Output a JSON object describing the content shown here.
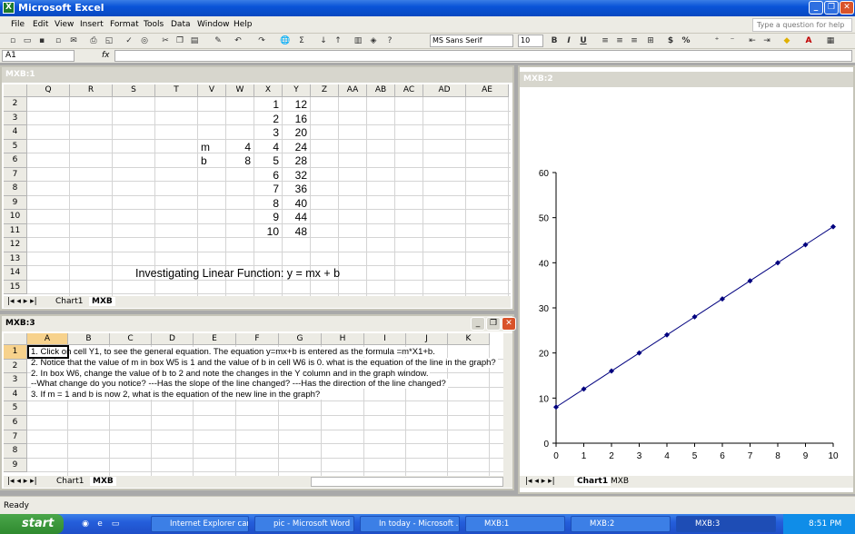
{
  "app": {
    "title": "Microsoft Excel",
    "icon": "excel-icon"
  },
  "menu": [
    "File",
    "Edit",
    "View",
    "Insert",
    "Format",
    "Tools",
    "Data",
    "Window",
    "Help"
  ],
  "help_placeholder": "Type a question for help",
  "toolbar": {
    "font_name": "MS Sans Serif",
    "font_size": "10",
    "bold": "B",
    "italic": "I",
    "underline": "U",
    "currency": "$",
    "percent": "%",
    "sigma": "Σ"
  },
  "formula_bar": {
    "name_box": "A1",
    "fx": "fx",
    "formula": ""
  },
  "win1": {
    "title": "MXB:1",
    "columns": [
      "Q",
      "R",
      "S",
      "T",
      "V",
      "W",
      "X",
      "Y",
      "Z",
      "AA",
      "AB",
      "AC",
      "AD",
      "AE"
    ],
    "rows": [
      "2",
      "3",
      "4",
      "5",
      "6",
      "7",
      "8",
      "9",
      "10",
      "11",
      "12",
      "13",
      "14",
      "15"
    ],
    "labels": {
      "m_label": "m",
      "m_value": "4",
      "b_label": "b",
      "b_value": "8"
    },
    "x_values": [
      "1",
      "2",
      "3",
      "4",
      "5",
      "6",
      "7",
      "8",
      "9",
      "10"
    ],
    "y_values": [
      "12",
      "16",
      "20",
      "24",
      "28",
      "32",
      "36",
      "40",
      "44",
      "48"
    ],
    "heading": "Investigating Linear Function: y = mx + b",
    "tabs": [
      "Chart1",
      "MXB"
    ]
  },
  "win2": {
    "title": "MXB:2",
    "tabs": [
      "Chart1",
      "MXB"
    ]
  },
  "win3": {
    "title": "MXB:3",
    "columns": [
      "A",
      "B",
      "C",
      "D",
      "E",
      "F",
      "G",
      "H",
      "I",
      "J",
      "K"
    ],
    "rows": [
      "1",
      "2",
      "3",
      "4",
      "5",
      "6",
      "7",
      "8",
      "9"
    ],
    "lines": [
      "1. Click on cell Y1, to see the general equation. The equation y=mx+b is entered as the formula  =m*X1+b.",
      "2. Notice that the value of m in box W5 is 1 and the value of b in cell W6 is 0.  what is the equation of the line in the graph?",
      "2. In box W6, change the value of b to 2 and note the changes in the Y column and in the graph window.",
      "    --What change do you notice? ---Has the slope of the line changed? ---Has the direction of the line changed?",
      "3. If m = 1 and b is now  2, what is the equation of the new line in the graph?"
    ],
    "tabs": [
      "Chart1",
      "MXB"
    ]
  },
  "chart_data": {
    "type": "line",
    "x": [
      0,
      1,
      2,
      3,
      4,
      5,
      6,
      7,
      8,
      9,
      10
    ],
    "series": [
      {
        "values": [
          8,
          12,
          16,
          20,
          24,
          28,
          32,
          36,
          40,
          44,
          48
        ],
        "color": "#00007f",
        "marker": "diamond"
      }
    ],
    "xticks": [
      "0",
      "1",
      "2",
      "3",
      "4",
      "5",
      "6",
      "7",
      "8",
      "9",
      "10"
    ],
    "yticks": [
      "0",
      "10",
      "20",
      "30",
      "40",
      "50",
      "60"
    ],
    "xlim": [
      0,
      10
    ],
    "ylim": [
      0,
      60
    ],
    "grid": false
  },
  "status": {
    "text": "Ready"
  },
  "taskbar": {
    "start": "start",
    "items": [
      "Internet Explorer can...",
      "pic - Microsoft Word",
      "In today - Microsoft ...",
      "MXB:1",
      "MXB:2",
      "MXB:3"
    ],
    "time": "8:51 PM"
  }
}
